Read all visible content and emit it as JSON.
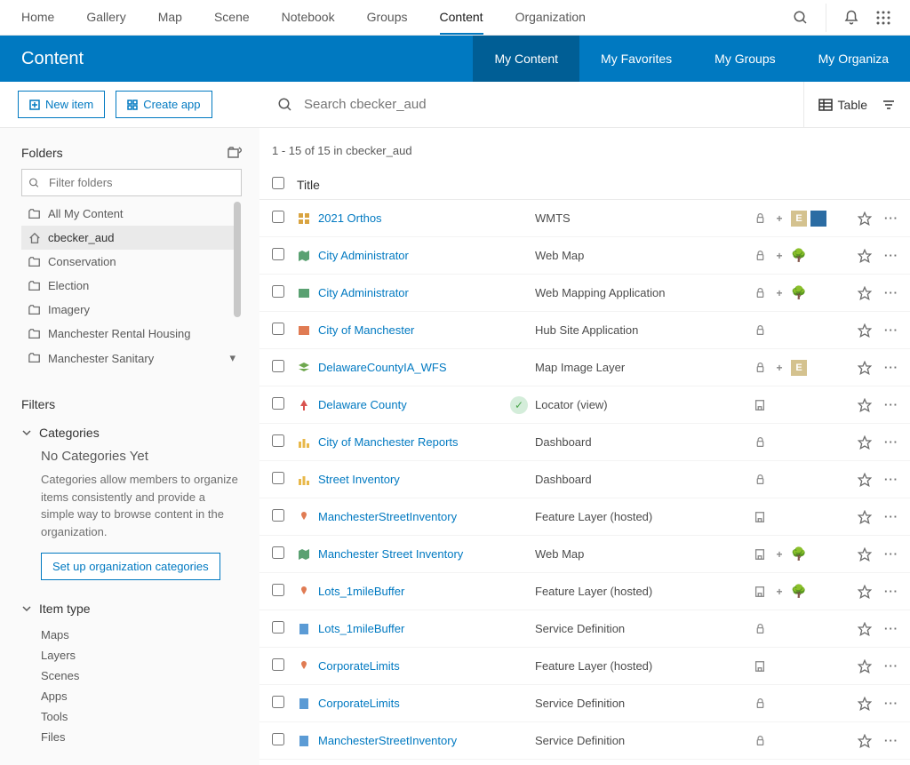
{
  "topnav": {
    "links": [
      "Home",
      "Gallery",
      "Map",
      "Scene",
      "Notebook",
      "Groups",
      "Content",
      "Organization"
    ],
    "active": "Content"
  },
  "bluebar": {
    "title": "Content",
    "tabs": [
      "My Content",
      "My Favorites",
      "My Groups",
      "My Organiza"
    ],
    "active": "My Content"
  },
  "toolbar": {
    "new_item": "New item",
    "create_app": "Create app",
    "search_placeholder": "Search cbecker_aud",
    "table_label": "Table"
  },
  "sidebar": {
    "folders_title": "Folders",
    "filter_placeholder": "Filter folders",
    "folders": [
      {
        "label": "All My Content",
        "icon": "folder"
      },
      {
        "label": "cbecker_aud",
        "icon": "home",
        "active": true
      },
      {
        "label": "Conservation",
        "icon": "folder"
      },
      {
        "label": "Election",
        "icon": "folder"
      },
      {
        "label": "Imagery",
        "icon": "folder"
      },
      {
        "label": "Manchester Rental Housing",
        "icon": "folder"
      },
      {
        "label": "Manchester Sanitary",
        "icon": "folder",
        "chevron": true
      }
    ],
    "filters_title": "Filters",
    "categories_label": "Categories",
    "nocats_title": "No Categories Yet",
    "nocats_desc": "Categories allow members to organize items consistently and provide a simple way to browse content in the organization.",
    "setup_categories": "Set up organization categories",
    "itemtype_label": "Item type",
    "itemtypes": [
      "Maps",
      "Layers",
      "Scenes",
      "Apps",
      "Tools",
      "Files"
    ]
  },
  "content": {
    "count_text": "1 - 15 of 15 in cbecker_aud",
    "title_header": "Title",
    "items": [
      {
        "title": "2021 Orthos",
        "type": "WMTS",
        "icon": "grid",
        "iconColor": "#d9a441",
        "flags": [
          "lock",
          "plus",
          "e",
          "blue"
        ]
      },
      {
        "title": "City Administrator",
        "type": "Web Map",
        "icon": "map",
        "iconColor": "#5aa172",
        "flags": [
          "lock",
          "plus",
          "tree"
        ]
      },
      {
        "title": "City Administrator",
        "type": "Web Mapping Application",
        "icon": "app",
        "iconColor": "#5aa172",
        "flags": [
          "lock",
          "plus",
          "tree"
        ]
      },
      {
        "title": "City of Manchester",
        "type": "Hub Site Application",
        "icon": "hub",
        "iconColor": "#e07b53",
        "flags": [
          "lock"
        ]
      },
      {
        "title": "DelawareCountyIA_WFS",
        "type": "Map Image Layer",
        "icon": "layer",
        "iconColor": "#6fa84f",
        "flags": [
          "lock",
          "plus",
          "e"
        ]
      },
      {
        "title": "Delaware County",
        "type": "Locator (view)",
        "icon": "locator",
        "iconColor": "#d9534f",
        "flags": [
          "org"
        ],
        "status": true
      },
      {
        "title": "City of Manchester Reports",
        "type": "Dashboard",
        "icon": "dash",
        "iconColor": "#e8b84a",
        "flags": [
          "lock"
        ]
      },
      {
        "title": "Street Inventory",
        "type": "Dashboard",
        "icon": "dash",
        "iconColor": "#e8b84a",
        "flags": [
          "lock"
        ]
      },
      {
        "title": "ManchesterStreetInventory",
        "type": "Feature Layer (hosted)",
        "icon": "feature",
        "iconColor": "#e07b53",
        "flags": [
          "org"
        ]
      },
      {
        "title": "Manchester Street Inventory",
        "type": "Web Map",
        "icon": "map",
        "iconColor": "#5aa172",
        "flags": [
          "org",
          "plus",
          "tree"
        ]
      },
      {
        "title": "Lots_1mileBuffer",
        "type": "Feature Layer (hosted)",
        "icon": "feature",
        "iconColor": "#e07b53",
        "flags": [
          "org",
          "plus",
          "tree"
        ]
      },
      {
        "title": "Lots_1mileBuffer",
        "type": "Service Definition",
        "icon": "sd",
        "iconColor": "#5b9bd5",
        "flags": [
          "lock"
        ]
      },
      {
        "title": "CorporateLimits",
        "type": "Feature Layer (hosted)",
        "icon": "feature",
        "iconColor": "#e07b53",
        "flags": [
          "org"
        ]
      },
      {
        "title": "CorporateLimits",
        "type": "Service Definition",
        "icon": "sd",
        "iconColor": "#5b9bd5",
        "flags": [
          "lock"
        ]
      },
      {
        "title": "ManchesterStreetInventory",
        "type": "Service Definition",
        "icon": "sd",
        "iconColor": "#5b9bd5",
        "flags": [
          "lock"
        ]
      }
    ]
  }
}
